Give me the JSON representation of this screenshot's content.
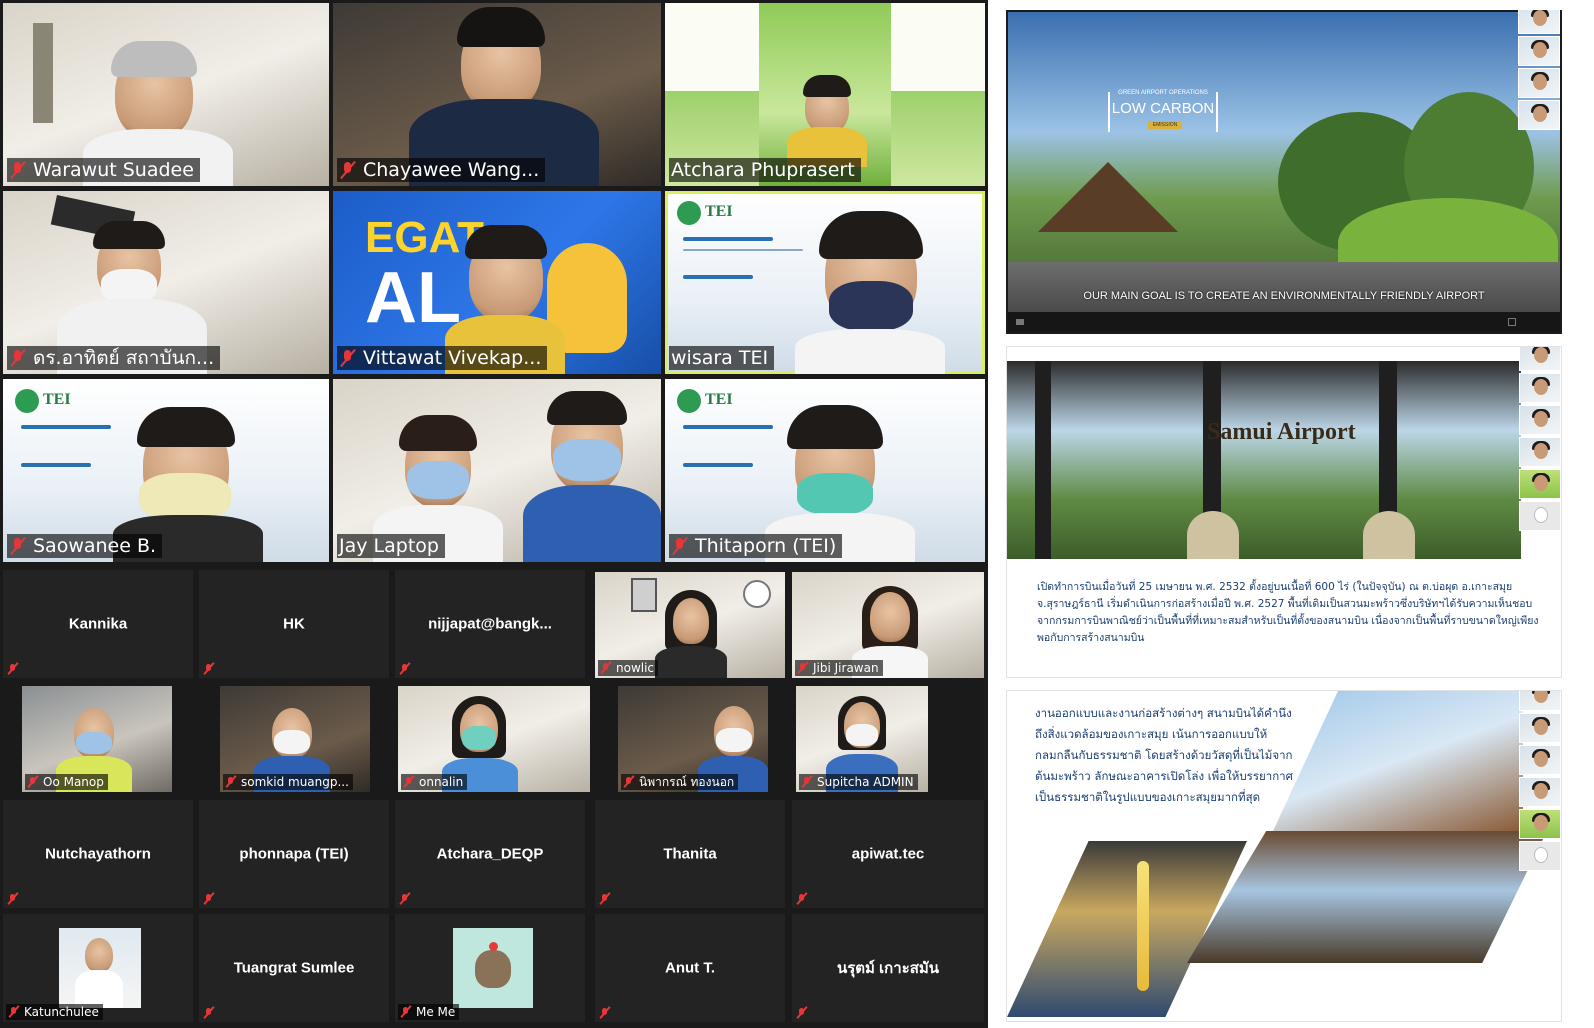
{
  "speaker_tiles": [
    {
      "name": "Warawut Suadee",
      "style": "room"
    },
    {
      "name": "Chayawee Wang...",
      "style": "dark"
    },
    {
      "name": "Atchara Phuprasert",
      "style": "green"
    },
    {
      "name": "ดร.อาทิตย์ สถาบันก...",
      "style": "room"
    },
    {
      "name": "Vittawat Vivekap...",
      "style": "egat"
    },
    {
      "name": "wisara TEI",
      "style": "tei"
    },
    {
      "name": "Saowanee B.",
      "style": "tei"
    },
    {
      "name": "Jay Laptop",
      "style": "room"
    },
    {
      "name": "Thitaporn (TEI)",
      "style": "tei"
    }
  ],
  "egat_text": [
    "EGAT",
    "AL"
  ],
  "tei_text": "TEI",
  "small_tiles": [
    {
      "name": "Kannika",
      "video": false
    },
    {
      "name": "HK",
      "video": false
    },
    {
      "name": "nijjapat@bangk...",
      "video": false
    },
    {
      "name": "nowlic",
      "video": true
    },
    {
      "name": "Jibi Jirawan",
      "video": true
    },
    {
      "name": "Oo Manop",
      "video": true
    },
    {
      "name": "somkid muangp...",
      "video": true
    },
    {
      "name": "onnalin",
      "video": true
    },
    {
      "name": "นิพากรณ์ ทองนอก",
      "video": true
    },
    {
      "name": "Supitcha ADMIN",
      "video": true
    },
    {
      "name": "Nutchayathorn",
      "video": false
    },
    {
      "name": "phonnapa (TEI)",
      "video": false
    },
    {
      "name": "Atchara_DEQP",
      "video": false
    },
    {
      "name": "Thanita",
      "video": false
    },
    {
      "name": "apiwat.tec",
      "video": false
    },
    {
      "name": "Katunchulee",
      "video": true
    },
    {
      "name": "Tuangrat Sumlee",
      "video": false
    },
    {
      "name": "Me Me",
      "video": true
    },
    {
      "name": "Anut T.",
      "video": false
    },
    {
      "name": "นรุตม์ เกาะสมัน",
      "video": false
    }
  ],
  "slide1": {
    "kicker": "GREEN AIRPORT OPERATIONS",
    "title": "LOW CARBON",
    "tag": "EMISSION",
    "caption": "OUR MAIN GOAL IS TO CREATE AN ENVIRONMENTALLY FRIENDLY AIRPORT"
  },
  "slide2": {
    "sign": "Samui Airport",
    "body": "เปิดทำการบินเมื่อวันที่ 25 เมษายน พ.ศ. 2532 ตั้งอยู่บนเนื้อที่ 600 ไร่ (ในปัจจุบัน) ณ ต.บ่อผุด อ.เกาะสมุย จ.สุราษฎร์ธานี เริ่มดำเนินการก่อสร้างเมื่อปี พ.ศ. 2527 พื้นที่เดิมเป็นสวนมะพร้าวซึ่งบริษัทฯได้รับความเห็นชอบจากกรมการบินพาณิชย์ว่าเป็นพื้นที่ที่เหมาะสมสำหรับเป็นที่ตั้งของสนามบิน เนื่องจากเป็นพื้นที่ราบขนาดใหญ่เพียงพอกับการสร้างสนามบิน"
  },
  "slide3": {
    "body": "งานออกแบบและงานก่อสร้างต่างๆ สนามบินได้คำนึงถึงสิ่งแวดล้อมของเกาะสมุย เน้นการออกแบบให้กลมกลืนกับธรรมชาติ โดยสร้างด้วยวัสดุที่เป็นไม้จากต้นมะพร้าว ลักษณะอาคารเปิดโล่ง เพื่อให้บรรยากาศเป็นธรรมชาติในรูปแบบของเกาะสมุยมากที่สุด"
  },
  "colors": {
    "grid_bg": "#1a1a1a",
    "tile_bg": "#232323",
    "active_speaker": "#d7f05b",
    "muted": "#e5363a"
  }
}
